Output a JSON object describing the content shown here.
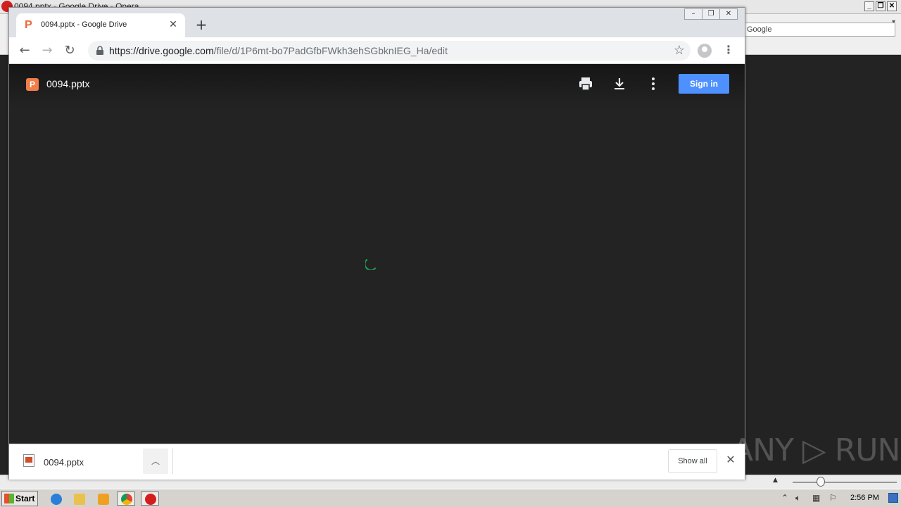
{
  "opera": {
    "window_title": "0094.pptx - Google Drive - Opera",
    "search_placeholder": "Google"
  },
  "chrome": {
    "tab": {
      "title": "0094.pptx - Google Drive"
    },
    "url_host": "https://drive.google.com",
    "url_path": "/file/d/1P6mt-bo7PadGfbFWkh3ehSGbknIEG_Ha/edit"
  },
  "viewer": {
    "file_name": "0094.pptx",
    "file_icon_letter": "P",
    "sign_in_label": "Sign in",
    "accent_color": "#4d90fe",
    "spinner_color": "#1e9e5a"
  },
  "download_shelf": {
    "file_name": "0094.pptx",
    "show_all_label": "Show all"
  },
  "taskbar": {
    "start_label": "Start",
    "clock": "2:56 PM"
  },
  "watermark": "ANY ▷ RUN"
}
